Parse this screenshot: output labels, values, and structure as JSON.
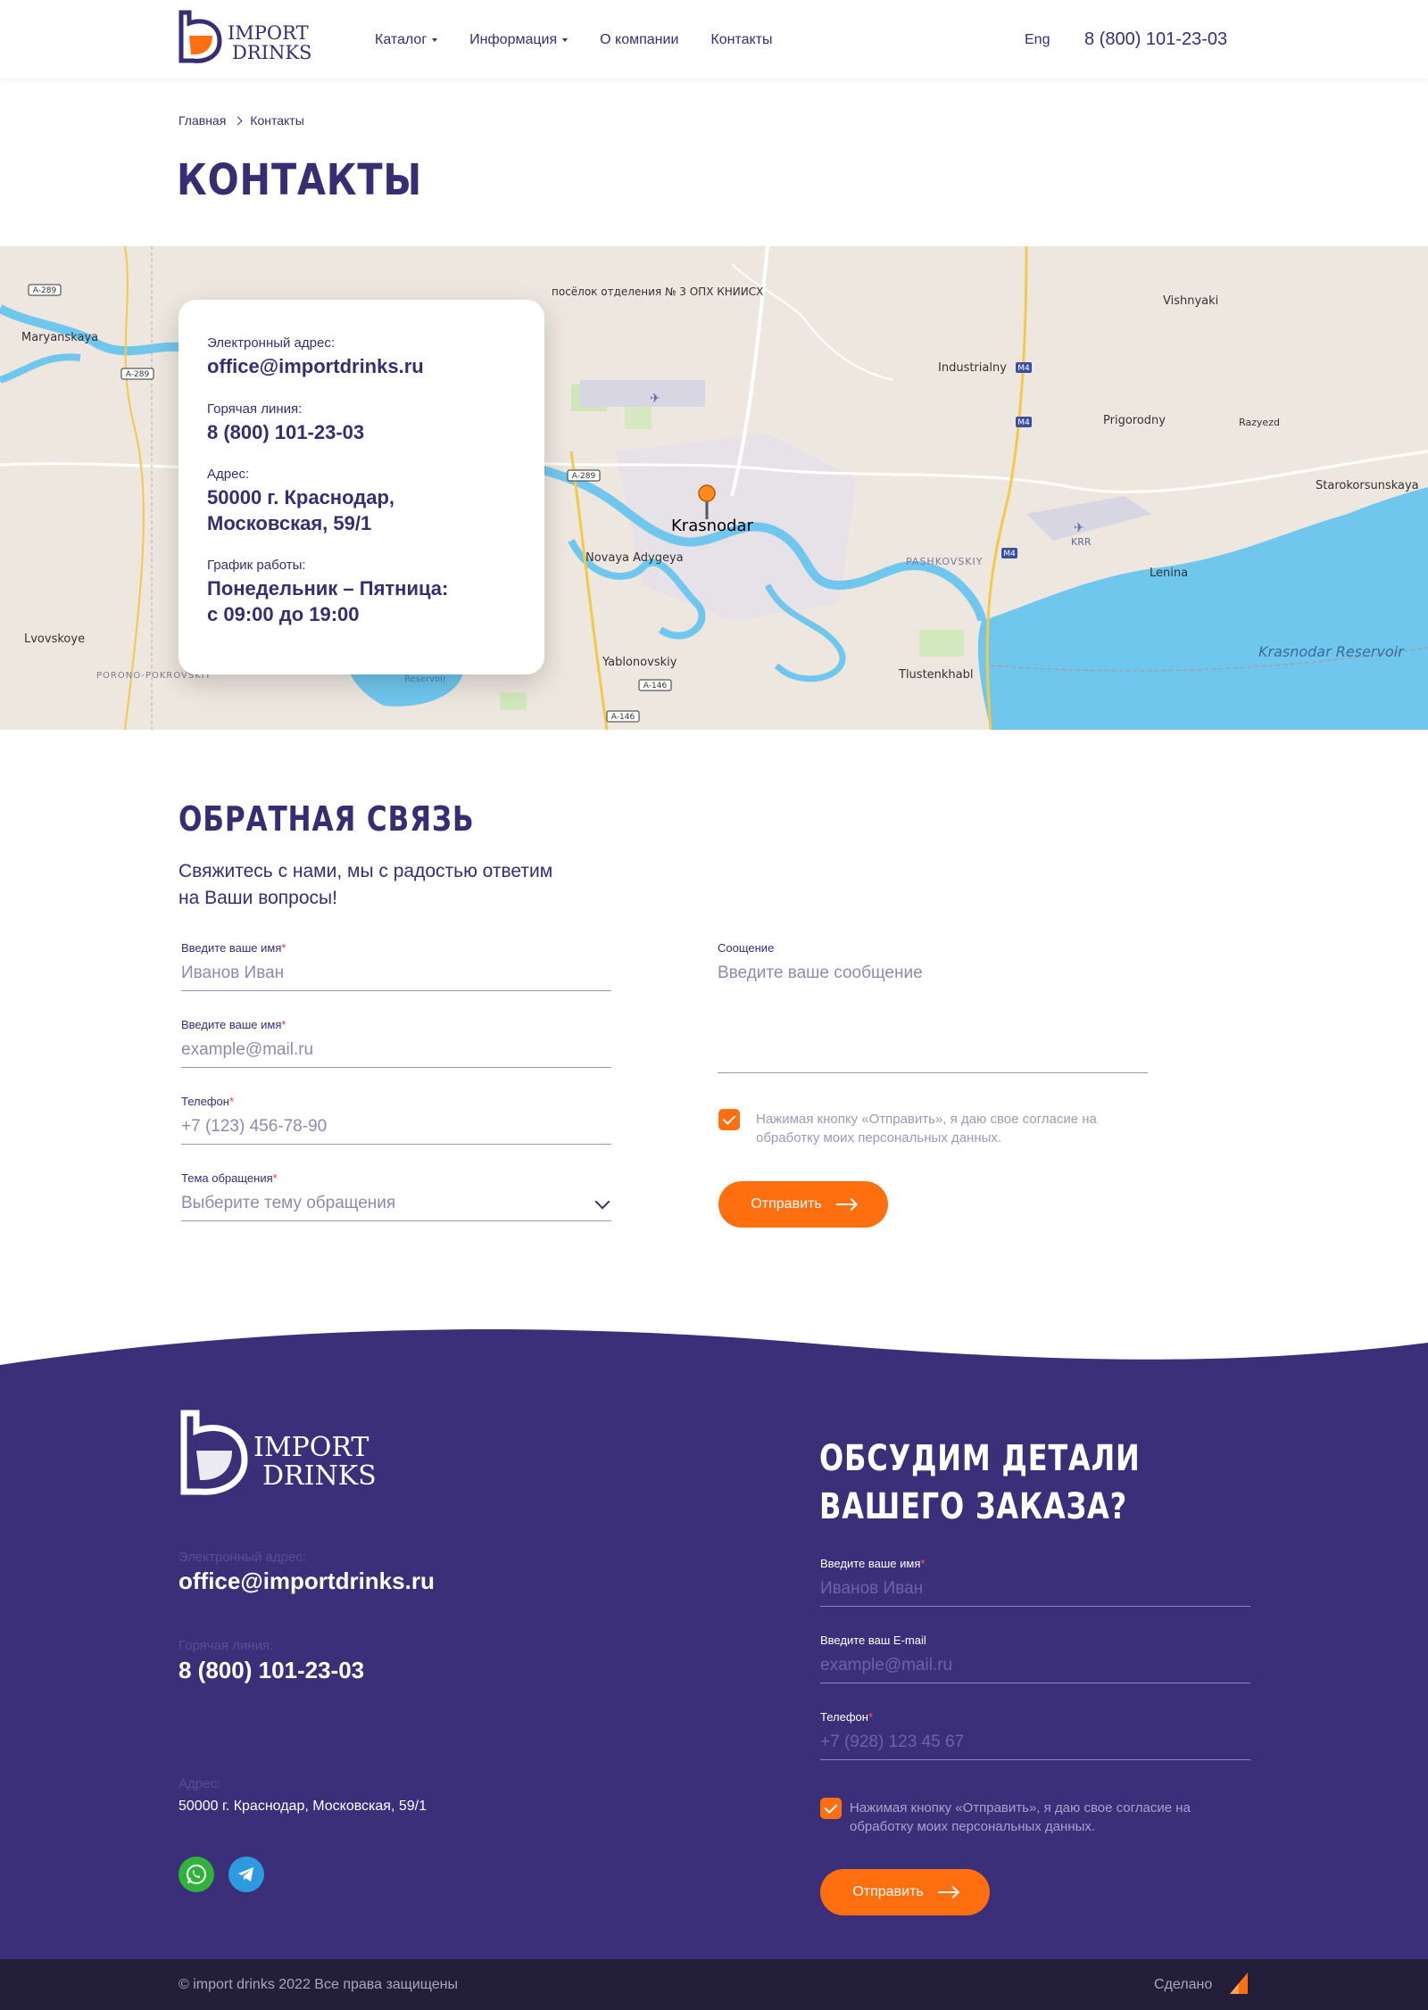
{
  "header": {
    "logo_text_top": "IMPORT",
    "logo_text_bottom": "DRINKS",
    "nav": [
      {
        "label": "Каталог",
        "dropdown": true
      },
      {
        "label": "Информация",
        "dropdown": true
      },
      {
        "label": "О компании",
        "dropdown": false
      },
      {
        "label": "Контакты",
        "dropdown": false
      }
    ],
    "lang": "Eng",
    "phone": "8 (800) 101-23-03"
  },
  "breadcrumb": {
    "home": "Главная",
    "current": "Контакты"
  },
  "page_title": "Контакты",
  "map": {
    "places": [
      "Maryanskaya",
      "посёлок отделения № 3 ОПХ КНИИСХ",
      "Vishnyaki",
      "Industrialny",
      "Prigorodny",
      "Razyezd",
      "Starokorsunskaya",
      "Krasnodar",
      "Novaya Adygeya",
      "PASHKOVSKIY",
      "KRR",
      "Lenina",
      "Lvovskoye",
      "PORONO-POKROVSKIY",
      "Reservoir",
      "Yablonovskiy",
      "Tlustenkhabl",
      "Krasnodar Reservoir"
    ],
    "roads": [
      "A-289",
      "A-289",
      "A-289",
      "M4",
      "M4",
      "M4",
      "A-146",
      "A-146"
    ]
  },
  "contact_card": {
    "email_label": "Электронный адрес:",
    "email": "office@importdrinks.ru",
    "hotline_label": "Горячая линия:",
    "hotline": " 8 (800) 101-23-03",
    "address_label": "Адрес:",
    "address_line1": "50000 г. Краснодар,",
    "address_line2": "Московская, 59/1",
    "schedule_label": "График работы:",
    "schedule_line1": "Понедельник – Пятница:",
    "schedule_line2": "с 09:00 до 19:00"
  },
  "feedback": {
    "title": "Обратная связь",
    "subtitle_line1": "Свяжитесь с нами, мы с радостью ответим",
    "subtitle_line2": "на Ваши вопросы!",
    "name_label": "Введите ваше имя",
    "name_placeholder": "Иванов Иван",
    "email_label": "Введите ваше имя",
    "email_placeholder": "example@mail.ru",
    "phone_label": "Телефон",
    "phone_placeholder": "+7 (123) 456-78-90",
    "topic_label": "Тема обращения",
    "topic_placeholder": "Выберите тему обращения",
    "message_label": "Соощение",
    "message_placeholder": "Введите ваше сообщение",
    "consent_line1": "Нажимая кнопку «Отправить», я даю свое согласие на",
    "consent_line2": "обработку моих персональных данных.",
    "submit": "Отправить",
    "required_mark": "*"
  },
  "footer": {
    "logo_text_top": "IMPORT",
    "logo_text_bottom": "DRINKS",
    "email_label": "Электронный адрес:",
    "email": "office@importdrinks.ru",
    "hotline_label": "Горячая линия:",
    "hotline": " 8 (800) 101-23-03",
    "address_label": "Адрес:",
    "address": "50000 г. Краснодар, Московская, 59/1",
    "form_title_line1": "Обсудим детали",
    "form_title_line2": "вашего заказа?",
    "name_label": "Введите ваше имя",
    "name_placeholder": "Иванов Иван",
    "email_field_label": "Введите ваш E-mail",
    "email_placeholder": "example@mail.ru",
    "phone_label": "Телефон",
    "phone_placeholder": "+7 (928) 123 45 67",
    "consent_line1": "Нажимая кнопку «Отправить», я даю свое согласие на",
    "consent_line2": "обработку моих персональных данных.",
    "submit": "Отправить",
    "copyright": "© import drinks 2022 Все права защищены",
    "made_by": "Сделано",
    "required_mark": "*"
  },
  "colors": {
    "brand_purple": "#372d73",
    "accent_orange": "#ff6f0f",
    "footer_bg": "#3a2f78",
    "bottom_bar": "#231f3a"
  },
  "icons": [
    "whatsapp-icon",
    "telegram-icon",
    "map-pin-icon",
    "chevron-down-icon",
    "arrow-right-icon",
    "check-icon"
  ]
}
